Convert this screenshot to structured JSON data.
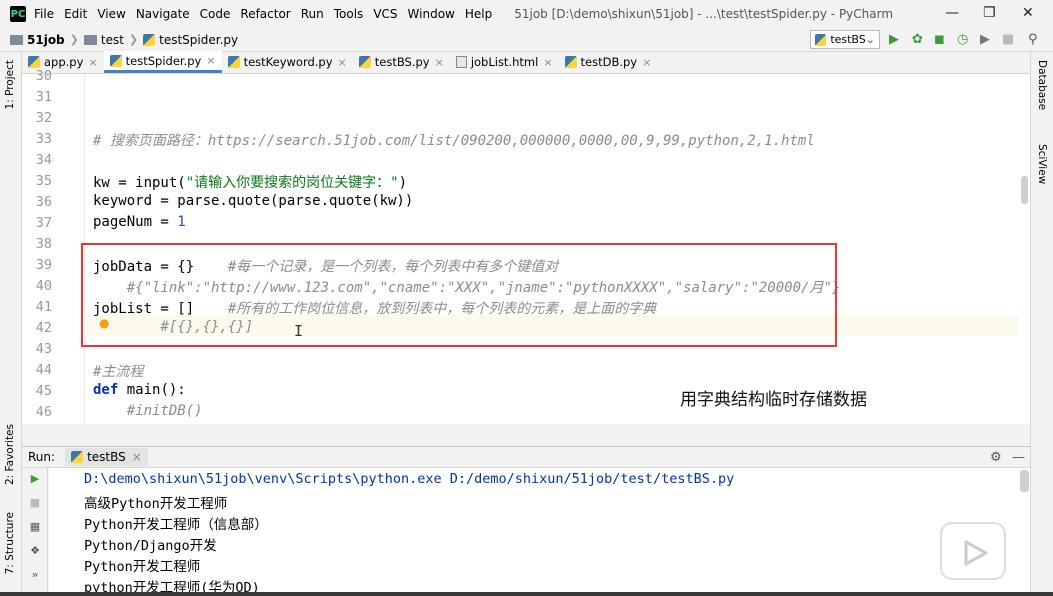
{
  "menubar": {
    "logo_text": "PC",
    "items": [
      "File",
      "Edit",
      "View",
      "Navigate",
      "Code",
      "Refactor",
      "Run",
      "Tools",
      "VCS",
      "Window",
      "Help"
    ],
    "window_title": "51job [D:\\demo\\shixun\\51job] - ...\\test\\testSpider.py - PyCharm"
  },
  "navbar": {
    "breadcrumb": [
      "51job",
      "test",
      "testSpider.py"
    ],
    "run_config": "testBS"
  },
  "tabs": [
    {
      "label": "app.py"
    },
    {
      "label": "testSpider.py",
      "active": true
    },
    {
      "label": "testKeyword.py"
    },
    {
      "label": "testBS.py"
    },
    {
      "label": "jobList.html"
    },
    {
      "label": "testDB.py"
    }
  ],
  "left_strip": {
    "project": "1: Project",
    "favorites": "2: Favorites",
    "structure": "7: Structure"
  },
  "right_strip": {
    "database": "Database",
    "sciview": "SciView"
  },
  "editor": {
    "line_numbers": [
      "30",
      "31",
      "32",
      "33",
      "34",
      "35",
      "36",
      "37",
      "38",
      "39",
      "40",
      "41",
      "42",
      "43",
      "44",
      "45",
      "46"
    ],
    "lines": {
      "l33": "# 搜索页面路径：https://search.51job.com/list/090200,000000,0000,00,9,99,python,2,1.html",
      "l35_a": "kw = input(",
      "l35_b": "\"请输入你要搜索的岗位关键字：\"",
      "l35_c": ")",
      "l36": "keyword = parse.quote(parse.quote(kw))",
      "l37_a": "pageNum = ",
      "l37_b": "1",
      "l39_a": "jobData = {}    ",
      "l39_b": "#每一个记录，是一个列表，每个列表中有多个键值对",
      "l40": "    #{\"link\":\"http://www.123.com\",\"cname\":\"XXX\",\"jname\":\"pythonXXXX\",\"salary\":\"20000/月\"}",
      "l41_a": "jobList = []    ",
      "l41_b": "#所有的工作岗位信息，放到列表中，每个列表的元素，是上面的字典",
      "l42": "        #[{},{},{}]",
      "l44": "#主流程",
      "l45_a": "def",
      "l45_b": " main():",
      "l46": "    #initDB()"
    }
  },
  "annotation": "用字典结构临时存储数据",
  "run": {
    "label": "Run:",
    "tab": "testBS",
    "output": [
      "D:\\demo\\shixun\\51job\\venv\\Scripts\\python.exe D:/demo/shixun/51job/test/testBS.py",
      "高级Python开发工程师",
      "Python开发工程师（信息部）",
      "Python/Django开发",
      "Python开发工程师",
      "python开发工程师(华为OD)"
    ]
  }
}
